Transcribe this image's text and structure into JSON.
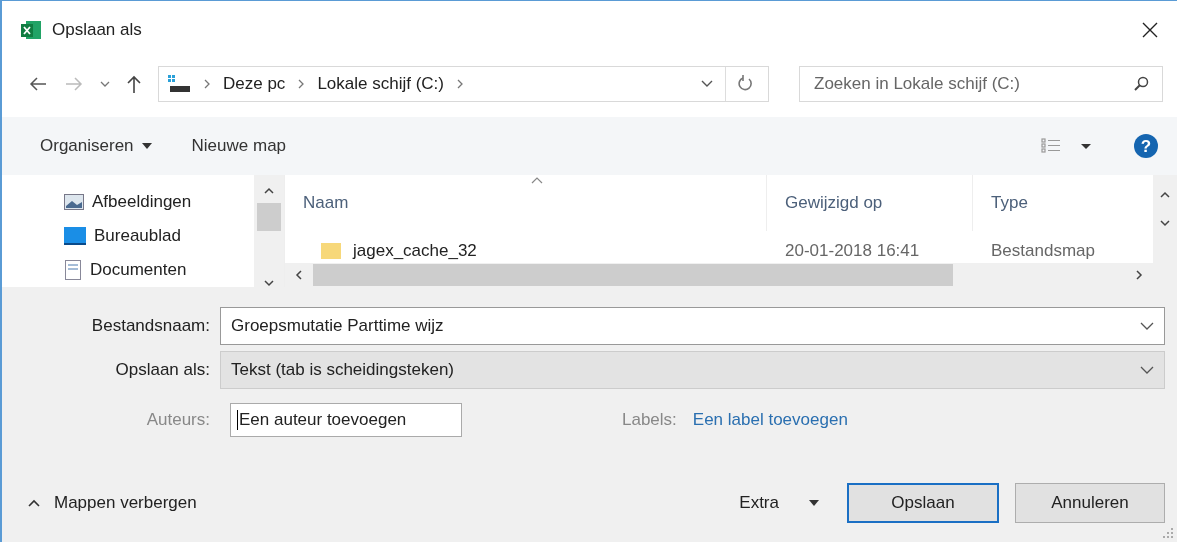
{
  "window": {
    "title": "Opslaan als"
  },
  "address_bar": {
    "crumbs": [
      "Deze pc",
      "Lokale schijf (C:)"
    ]
  },
  "search": {
    "placeholder": "Zoeken in Lokale schijf (C:)"
  },
  "toolbar": {
    "organize": "Organiseren",
    "new_folder": "Nieuwe map",
    "help": "?"
  },
  "sidebar": {
    "items": [
      {
        "label": "Afbeeldingen",
        "kind": "pictures"
      },
      {
        "label": "Bureaublad",
        "kind": "desktop"
      },
      {
        "label": "Documenten",
        "kind": "documents"
      }
    ]
  },
  "file_list": {
    "columns": [
      "Naam",
      "Gewijzigd op",
      "Type"
    ],
    "rows": [
      {
        "name": "jagex_cache_32",
        "modified": "20-01-2018 16:41",
        "type": "Bestandsmap"
      }
    ]
  },
  "form": {
    "filename_label": "Bestandsnaam:",
    "filename": "Groepsmutatie Parttime wijz",
    "savetype_label": "Opslaan als:",
    "savetype": "Tekst (tab is scheidingsteken)",
    "authors_label": "Auteurs:",
    "authors": "Een auteur toevoegen",
    "tags_label": "Labels:",
    "tags_link": "Een label toevoegen"
  },
  "footer": {
    "hide_folders": "Mappen verbergen",
    "tools": "Extra",
    "buttons": [
      {
        "label": "Opslaan",
        "default": true
      },
      {
        "label": "Annuleren",
        "default": false
      }
    ]
  }
}
